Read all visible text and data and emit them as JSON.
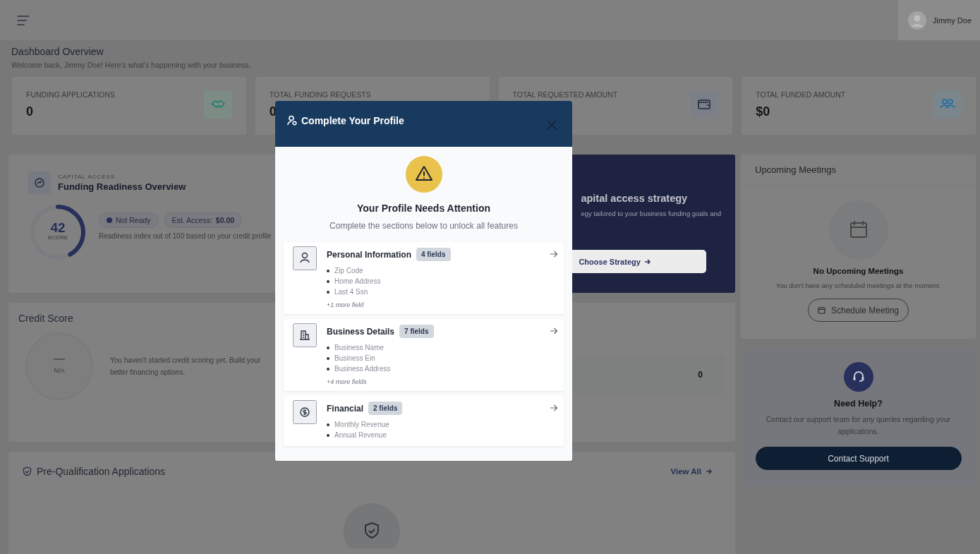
{
  "header": {
    "user_name": "Jimmy Doe"
  },
  "page": {
    "title": "Dashboard Overview",
    "subtitle": "Welcome back, Jimmy Doe! Here's what's happening with your business."
  },
  "stats": [
    {
      "label": "FUNDING APPLICATIONS",
      "value": "0"
    },
    {
      "label": "TOTAL FUNDING REQUESTS",
      "value": "0"
    },
    {
      "label": "TOTAL REQUESTED AMOUNT"
    },
    {
      "label": "TOTAL FUNDED AMOUNT",
      "value": "$0"
    }
  ],
  "readiness": {
    "eyebrow": "CAPITAL ACCESS",
    "title": "Funding Readiness Overview",
    "score": "42",
    "score_label": "SCORE",
    "level": 0.42,
    "status": "Not Ready",
    "access": "Est. Access: **$0.00**",
    "note": "Readiness index out of 100 based on your credit profile"
  },
  "strategy": {
    "title": "apital access strategy",
    "text": "egy tailored to your business funding goals and",
    "button": "Choose Strategy"
  },
  "credit_score": {
    "title": "Credit Score",
    "score": "N/A",
    "text_lines": [
      "You haven't started credit scoring yet. Build your",
      "better financing options."
    ],
    "count": "0"
  },
  "prequalification": {
    "title": "Pre-Qualification Applications",
    "link": "View All"
  },
  "meetings": {
    "title": "Upcoming Meetings",
    "empty_title": "No Upcoming Meetings",
    "empty_text": "You don't have any scheduled meetings at the moment.",
    "button": "Schedule Meeting"
  },
  "help": {
    "title": "Need Help?",
    "text": "Contact our support team for any queries regarding your applications.",
    "button": "Contact Support"
  },
  "modal": {
    "title": "Complete Your Profile",
    "heading": "Your Profile Needs Attention",
    "subheading": "Complete the sections below to unlock all features",
    "sections": [
      {
        "title": "Personal Information",
        "badge": "4 fields",
        "fields": [
          "Zip Code",
          "Home Address",
          "Last 4 Ssn"
        ],
        "more": "+1 more field"
      },
      {
        "title": "Business Details",
        "badge": "7 fields",
        "fields": [
          "Business Name",
          "Business Ein",
          "Business Address"
        ],
        "more": "+4 more fields"
      },
      {
        "title": "Financial",
        "badge": "2 fields",
        "fields": [
          "Monthly Revenue",
          "Annual Revenue"
        ]
      }
    ]
  }
}
